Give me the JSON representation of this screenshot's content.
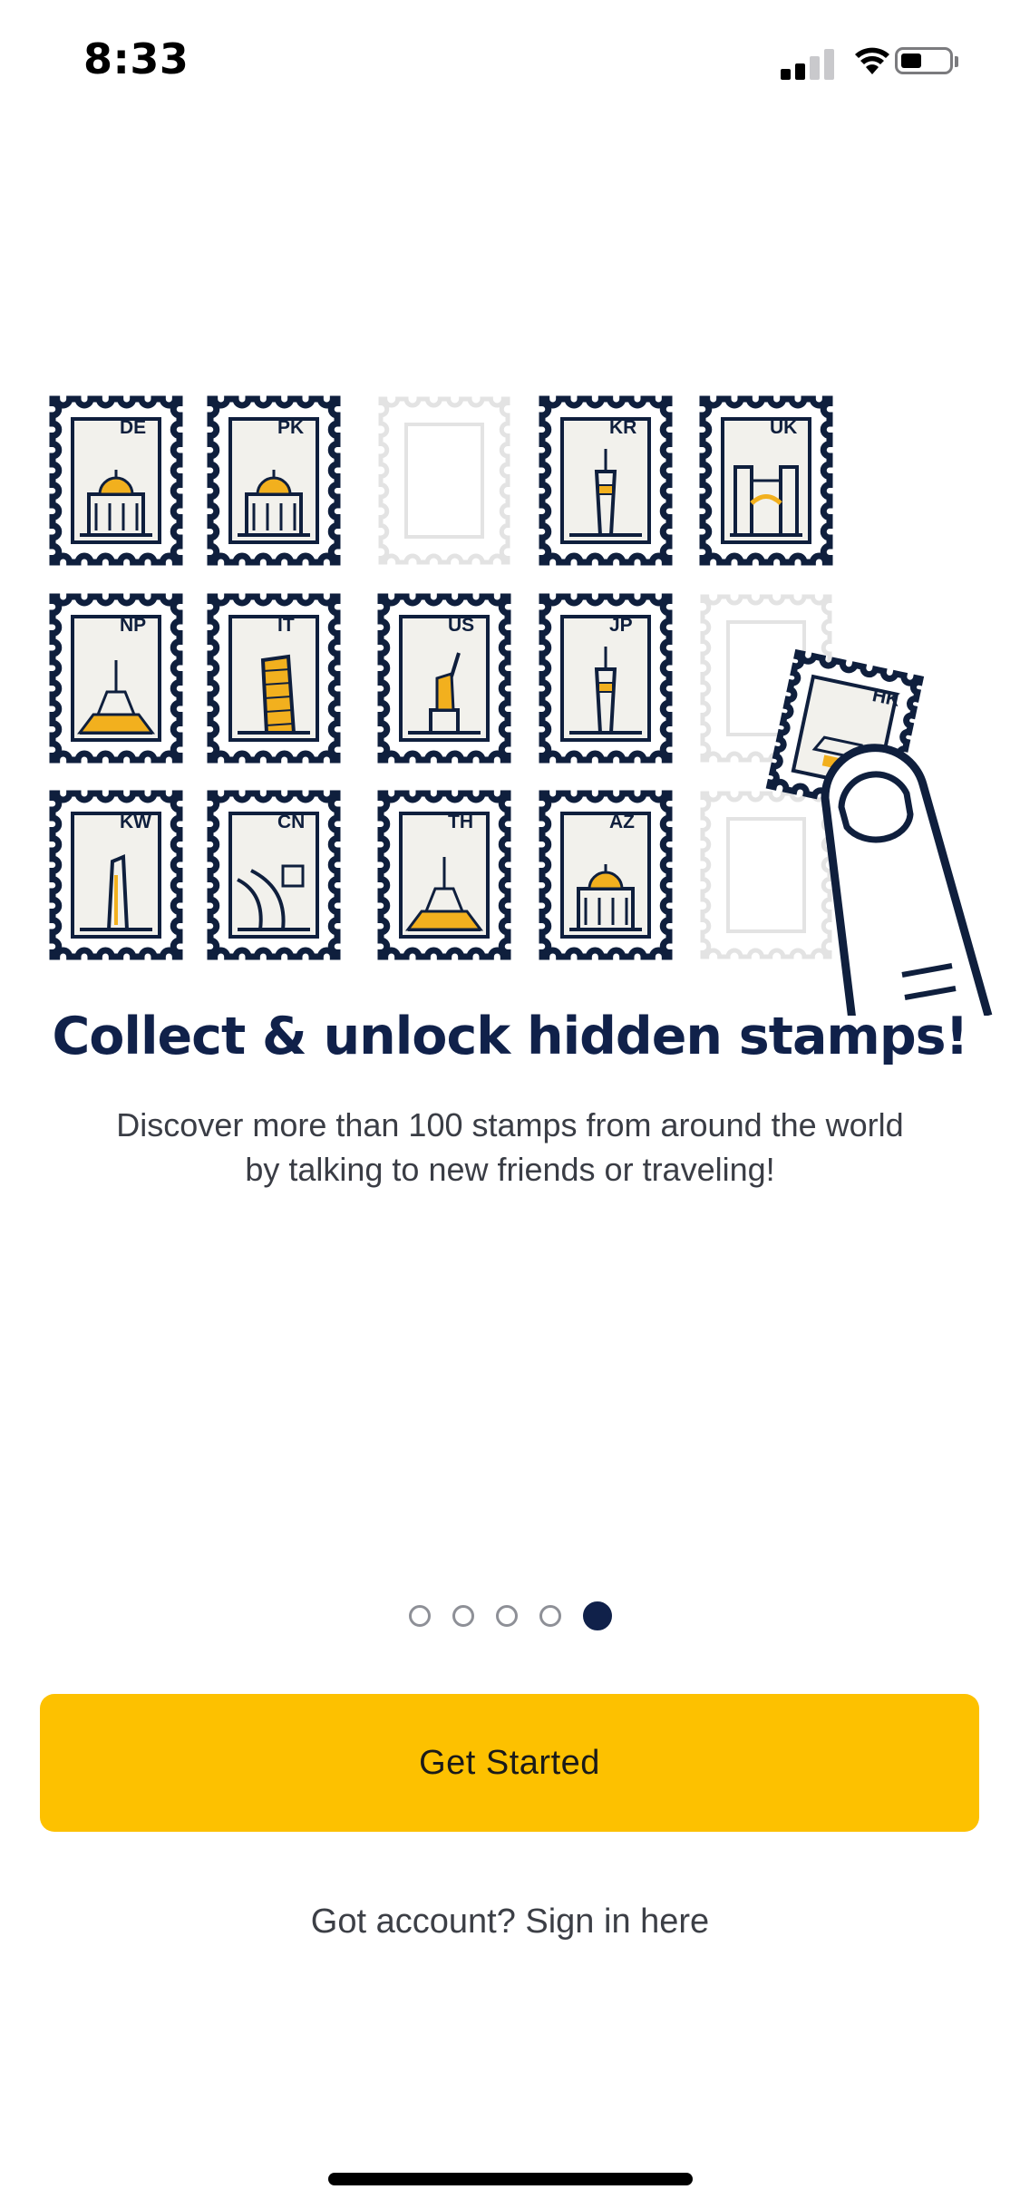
{
  "status_bar": {
    "time": "8:33",
    "icons": [
      "cellular-signal-icon",
      "wifi-icon",
      "battery-icon"
    ]
  },
  "illustration": {
    "stamps": [
      {
        "code": "DE",
        "state": "collected"
      },
      {
        "code": "PK",
        "state": "collected"
      },
      {
        "code": "",
        "state": "empty"
      },
      {
        "code": "KR",
        "state": "collected"
      },
      {
        "code": "UK",
        "state": "collected"
      },
      {
        "code": "NP",
        "state": "collected"
      },
      {
        "code": "IT",
        "state": "collected"
      },
      {
        "code": "US",
        "state": "collected"
      },
      {
        "code": "JP",
        "state": "collected"
      },
      {
        "code": "",
        "state": "empty"
      },
      {
        "code": "KW",
        "state": "collected"
      },
      {
        "code": "CN",
        "state": "collected"
      },
      {
        "code": "TH",
        "state": "collected"
      },
      {
        "code": "AZ",
        "state": "collected"
      },
      {
        "code": "",
        "state": "empty"
      }
    ],
    "held_stamp": {
      "code": "HK"
    },
    "colors": {
      "stamp_border": "#0f1f3d",
      "stamp_fill": "#f2f1ec",
      "empty_stamp": "#e3e3e3",
      "accent": "#f2b01e"
    }
  },
  "onboarding": {
    "title": "Collect & unlock hidden stamps!",
    "subtitle_line1": "Discover more than 100 stamps from around the world",
    "subtitle_line2": "by talking to new friends or traveling!",
    "page_count": 5,
    "active_page": 5
  },
  "cta": {
    "label": "Get Started",
    "color": "#fdc100"
  },
  "signin_link": "Got account? Sign in here"
}
